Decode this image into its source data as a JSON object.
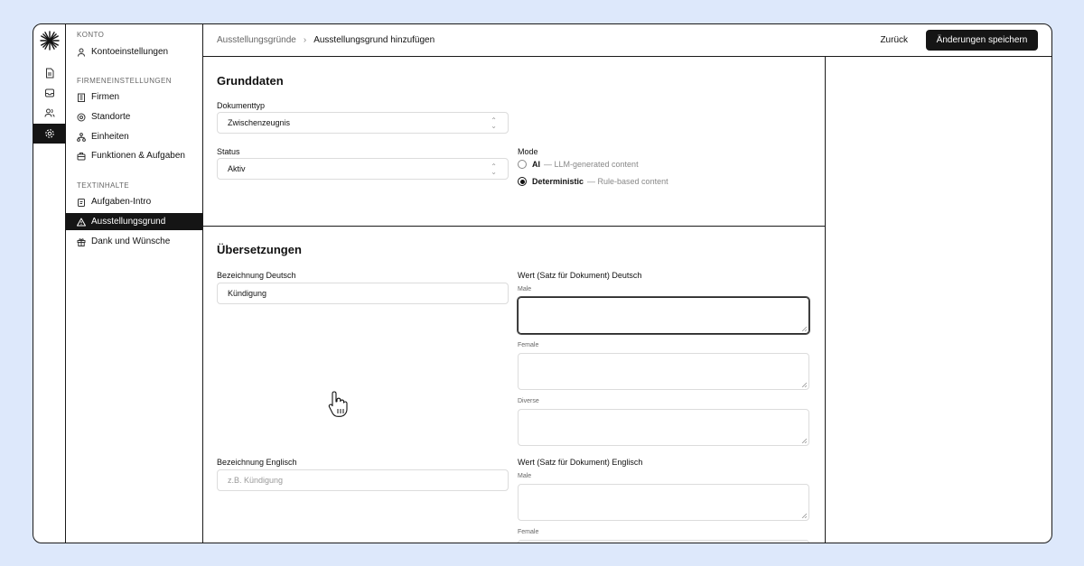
{
  "sidebar": {
    "sections": [
      {
        "title": "KONTO",
        "items": [
          {
            "label": "Kontoeinstellungen",
            "icon": "user-icon"
          }
        ]
      },
      {
        "title": "FIRMENEINSTELLUNGEN",
        "items": [
          {
            "label": "Firmen",
            "icon": "building-icon"
          },
          {
            "label": "Standorte",
            "icon": "location-pin-icon"
          },
          {
            "label": "Einheiten",
            "icon": "hierarchy-icon"
          },
          {
            "label": "Funktionen & Aufgaben",
            "icon": "briefcase-icon"
          }
        ]
      },
      {
        "title": "TEXTINHALTE",
        "items": [
          {
            "label": "Aufgaben-Intro",
            "icon": "clipboard-icon"
          },
          {
            "label": "Ausstellungsgrund",
            "icon": "warning-triangle-icon",
            "active": true
          },
          {
            "label": "Dank und Wünsche",
            "icon": "gift-icon"
          }
        ]
      }
    ]
  },
  "topbar": {
    "breadcrumb_parent": "Ausstellungsgründe",
    "breadcrumb_separator": "›",
    "breadcrumb_current": "Ausstellungsgrund hinzufügen",
    "back_label": "Zurück",
    "save_label": "Änderungen speichern"
  },
  "grunddaten": {
    "title": "Grunddaten",
    "dokumenttyp_label": "Dokumenttyp",
    "dokumenttyp_value": "Zwischenzeugnis",
    "status_label": "Status",
    "status_value": "Aktiv",
    "mode_label": "Mode",
    "mode_options": [
      {
        "label": "AI",
        "desc": "— LLM-generated content",
        "selected": false
      },
      {
        "label": "Deterministic",
        "desc": "— Rule-based content",
        "selected": true
      }
    ]
  },
  "uebersetzungen": {
    "title": "Übersetzungen",
    "de_label": "Bezeichnung Deutsch",
    "de_value": "Kündigung",
    "de_wert_label": "Wert (Satz für Dokument) Deutsch",
    "en_label": "Bezeichnung Englisch",
    "en_placeholder": "z.B. Kündigung",
    "en_wert_label": "Wert (Satz für Dokument) Englisch",
    "male": "Male",
    "female": "Female",
    "diverse": "Diverse"
  },
  "colors": {
    "accent": "#151515",
    "background": "#dde8fb"
  }
}
